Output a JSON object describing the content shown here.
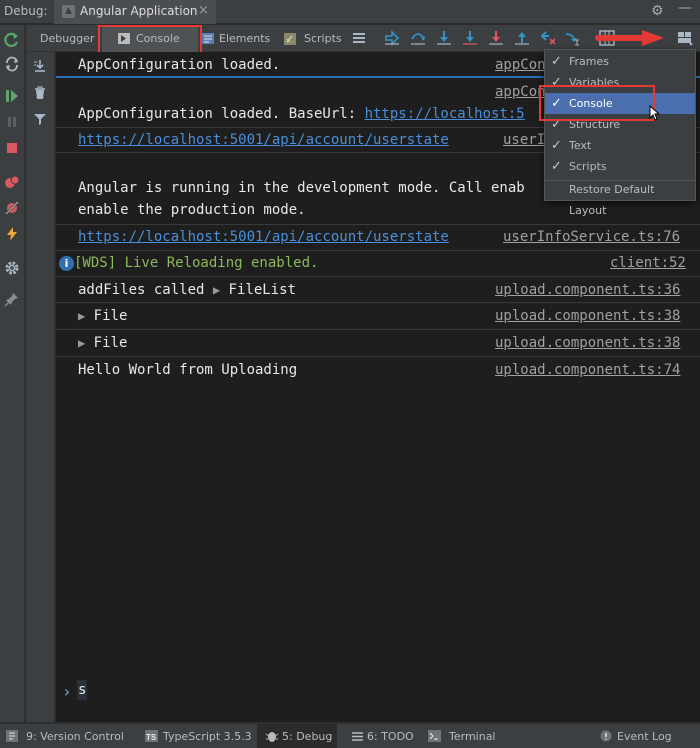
{
  "window": {
    "debug_label": "Debug:",
    "app_tab": "Angular Application",
    "close_glyph": "×",
    "settings_glyph": "⚙",
    "minimize_glyph": "—"
  },
  "toolbar": {
    "tabs": [
      {
        "label": "Debugger"
      },
      {
        "label": "Console",
        "selected": true
      },
      {
        "label": "Elements"
      },
      {
        "label": "Scripts"
      }
    ]
  },
  "console": {
    "rows": [
      {
        "text": "AppConfiguration loaded.",
        "source": "appCon"
      },
      {
        "text": "AppConfiguration loaded. BaseUrl: ",
        "link": "https://localhost:5",
        "source_top": "appCon",
        "source": "appCon"
      },
      {
        "link": "https://localhost:5001/api/account/userstate",
        "source": "userI"
      },
      {
        "text1": "Angular is running in the development mode. Call enab",
        "text2": "enable the production mode."
      },
      {
        "link": "https://localhost:5001/api/account/userstate",
        "source": "userInfoService.ts:76"
      },
      {
        "text": "[WDS] Live Reloading enabled.",
        "source": "client:52",
        "info_glyph": "i"
      },
      {
        "text": "addFiles called ",
        "object": "FileList",
        "source": "upload.component.ts:36"
      },
      {
        "object": "File",
        "source": "upload.component.ts:38"
      },
      {
        "object": "File",
        "source": "upload.component.ts:38"
      },
      {
        "text": "Hello World from Uploading",
        "source": "upload.component.ts:74"
      }
    ],
    "input_value": "s",
    "prompt_glyph": "›",
    "expand_glyph": "▶"
  },
  "menu": {
    "items": [
      {
        "label": "Frames",
        "checked": true
      },
      {
        "label": "Variables",
        "checked": true
      },
      {
        "label": "Console",
        "checked": true,
        "highlighted": true
      },
      {
        "label": "Structure",
        "checked": true
      },
      {
        "label": "Text",
        "checked": true
      },
      {
        "label": "Scripts",
        "checked": true
      }
    ],
    "restore_label": "Restore Default Layout",
    "check_glyph": "✓"
  },
  "statusbar": {
    "items": [
      {
        "label": "9: Version Control",
        "mnemonic": "9"
      },
      {
        "label": "TypeScript 3.5.3"
      },
      {
        "label": "5: Debug",
        "mnemonic": "5",
        "active": true
      },
      {
        "label": "6: TODO",
        "mnemonic": "6"
      },
      {
        "label": "Terminal"
      },
      {
        "label": "Event Log"
      }
    ]
  },
  "colors": {
    "accent_red": "#e53935",
    "menu_highlight": "#4b6eaf",
    "link_blue": "#4a8fd9",
    "wds_green": "#8db85b",
    "run_green": "#59a869"
  }
}
